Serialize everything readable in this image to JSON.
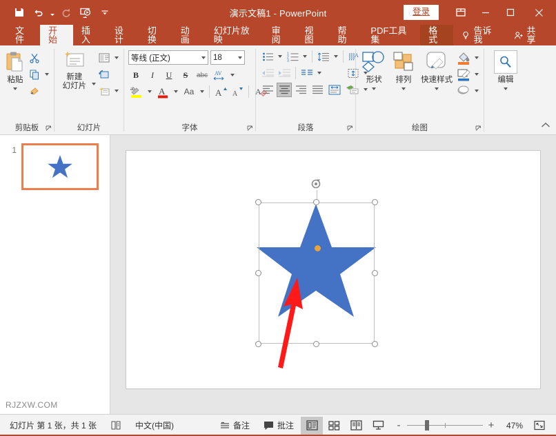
{
  "window": {
    "title": "演示文稿1  -  PowerPoint",
    "signin_label": "登录",
    "qat": [
      {
        "name": "save-icon",
        "label": "保存"
      },
      {
        "name": "undo-icon",
        "label": "撤消"
      },
      {
        "name": "redo-icon",
        "label": "恢复"
      },
      {
        "name": "start-slideshow-icon",
        "label": "从头开始"
      },
      {
        "name": "customize-qat-icon",
        "label": "自定义快速访问工具栏"
      }
    ],
    "controls": [
      {
        "name": "ribbon-display-options-icon",
        "label": "功能区显示选项"
      },
      {
        "name": "minimize-icon",
        "label": "最小化"
      },
      {
        "name": "maximize-icon",
        "label": "最大化"
      },
      {
        "name": "close-icon",
        "label": "关闭"
      }
    ],
    "accent_color": "#B7472A"
  },
  "tabs": {
    "items": [
      {
        "label": "文件",
        "active": false
      },
      {
        "label": "开始",
        "active": true
      },
      {
        "label": "插入",
        "active": false
      },
      {
        "label": "设计",
        "active": false
      },
      {
        "label": "切换",
        "active": false
      },
      {
        "label": "动画",
        "active": false
      },
      {
        "label": "幻灯片放映",
        "active": false
      },
      {
        "label": "审阅",
        "active": false
      },
      {
        "label": "视图",
        "active": false
      },
      {
        "label": "帮助",
        "active": false
      },
      {
        "label": "PDF工具集",
        "active": false
      },
      {
        "label": "格式",
        "active": false,
        "contextual": true
      }
    ],
    "tellme": "告诉我",
    "share": "共享"
  },
  "ribbon": {
    "groups": [
      {
        "label": "剪贴板",
        "big": {
          "label": "粘贴",
          "icon": "paste-icon"
        },
        "small": [
          {
            "label": "剪切",
            "icon": "cut-icon"
          },
          {
            "label": "复制",
            "icon": "copy-icon"
          },
          {
            "label": "格式刷",
            "icon": "format-painter-icon"
          }
        ]
      },
      {
        "label": "幻灯片",
        "big": {
          "label": "新建\n幻灯片",
          "line1": "新建",
          "line2": "幻灯片",
          "icon": "new-slide-icon"
        },
        "small": [
          {
            "label": "版式",
            "icon": "layout-icon"
          },
          {
            "label": "重设",
            "icon": "reset-icon"
          },
          {
            "label": "节",
            "icon": "section-icon"
          }
        ]
      },
      {
        "label": "字体",
        "font_name": "等线 (正文)",
        "font_size": "18",
        "buttons_row1": [
          "B",
          "I",
          "U",
          "S",
          "abc",
          "AV"
        ],
        "buttons_row2": [
          "aby",
          "A",
          "Aa",
          "A↑",
          "A↓",
          "清除格式"
        ]
      },
      {
        "label": "段落",
        "buttons": [
          "项目符号",
          "编号",
          "降低列表级别",
          "提高列表级别",
          "行距",
          "文字方向",
          "对齐文本",
          "左对齐",
          "居中",
          "右对齐",
          "两端对齐",
          "分栏",
          "转换为 SmartArt"
        ]
      },
      {
        "label": "绘图",
        "big": [
          {
            "label": "形状",
            "icon": "shapes-icon"
          },
          {
            "label": "排列",
            "icon": "arrange-icon"
          },
          {
            "label": "快速样式",
            "icon": "quick-styles-icon"
          }
        ],
        "small": [
          {
            "label": "形状填充",
            "icon": "shape-fill-icon"
          },
          {
            "label": "形状轮廓",
            "icon": "shape-outline-icon"
          },
          {
            "label": "形状效果",
            "icon": "shape-effects-icon"
          }
        ]
      },
      {
        "label": "",
        "big": {
          "label": "编辑",
          "icon": "find-icon"
        }
      }
    ],
    "collapse_label": "折叠功能区"
  },
  "thumbnails": {
    "slides": [
      {
        "number": "1",
        "selected": true,
        "shape": "blue-star"
      }
    ],
    "watermark": "RJZXW.COM"
  },
  "slide": {
    "shape": {
      "type": "5-point-star",
      "fill": "#4472C4",
      "selected": true,
      "handles": 8,
      "rotation_handle": true,
      "adjustment_handle_color": "#E8A33D"
    },
    "annotation": {
      "type": "red-arrow",
      "color": "#FF1A1A"
    }
  },
  "status": {
    "slide_info": "幻灯片 第 1 张，共 1 张",
    "language": "中文(中国)",
    "notes_label": "备注",
    "comments_label": "批注",
    "accessibility_icon": "accessibility-icon",
    "views": [
      {
        "name": "normal-view",
        "label": "普通视图",
        "selected": true
      },
      {
        "name": "slide-sorter-view",
        "label": "幻灯片浏览",
        "selected": false
      },
      {
        "name": "reading-view",
        "label": "阅读视图",
        "selected": false
      },
      {
        "name": "slideshow-view",
        "label": "幻灯片放映",
        "selected": false
      }
    ],
    "zoom_out": "-",
    "zoom_in": "+",
    "zoom_percent": "47%",
    "fit_label": "使幻灯片适应当前窗口"
  }
}
